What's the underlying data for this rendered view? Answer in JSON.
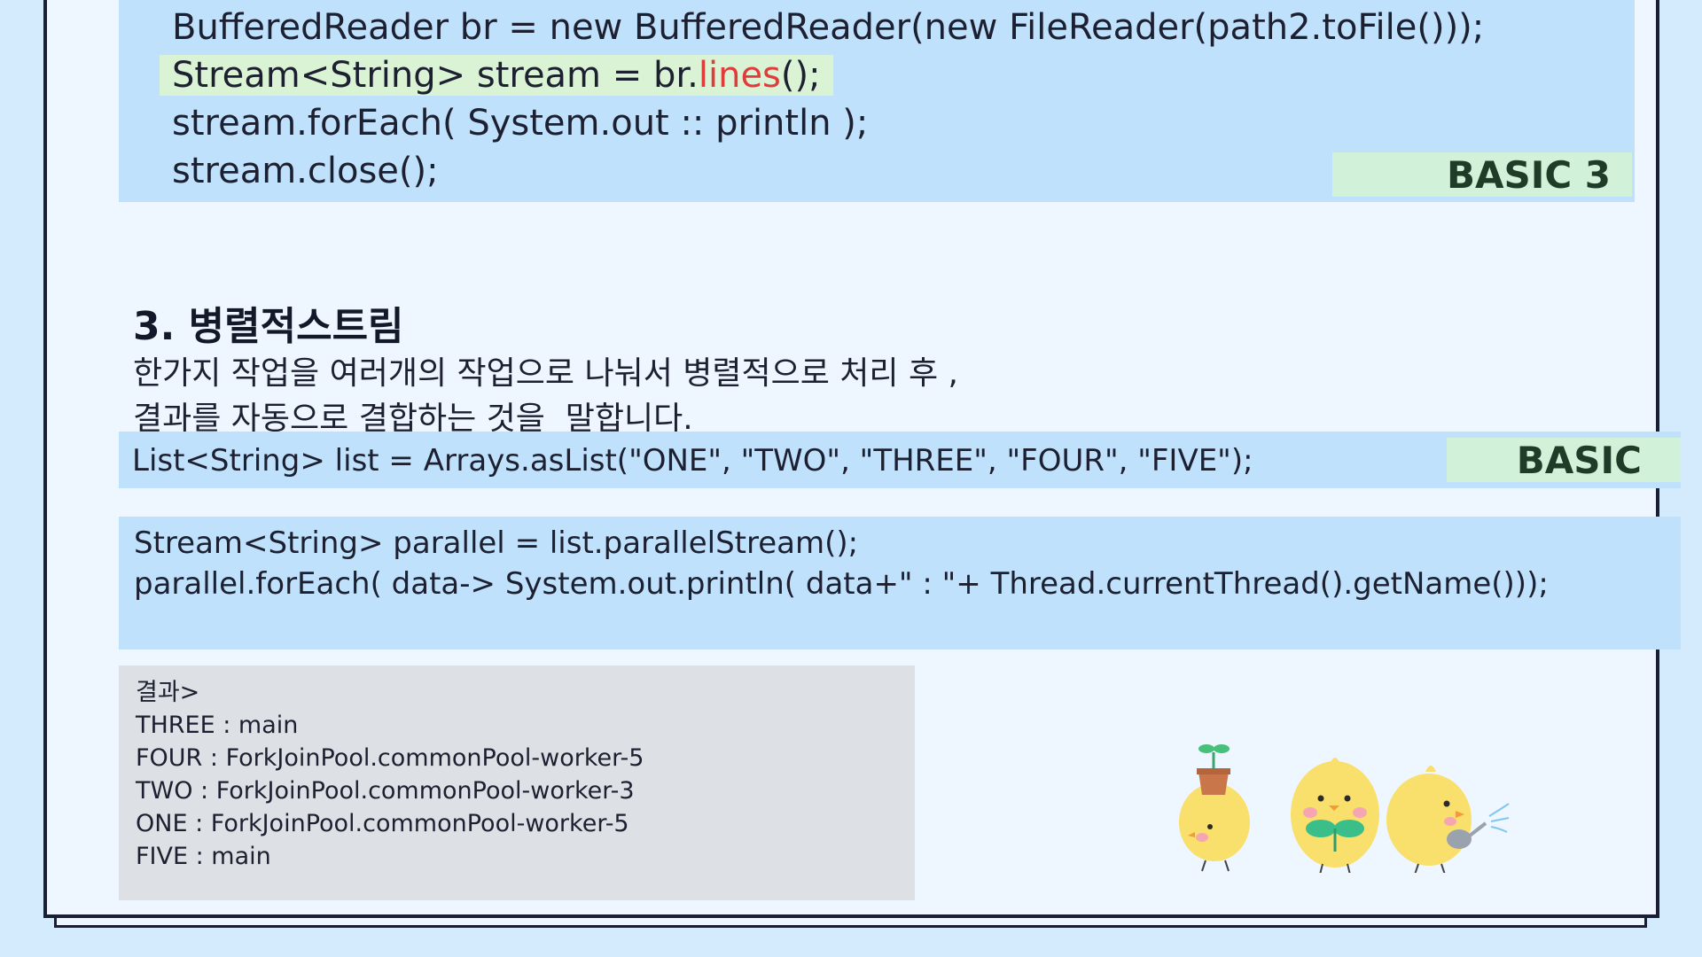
{
  "code_top": {
    "lines": [
      "BufferedReader br = new BufferedReader(new FileReader(path2.toFile()));",
      "Stream<String> stream = br.",
      "stream.forEach( System.out :: println );",
      "stream.close();"
    ],
    "line2_method": "lines",
    "line2_suffix": "();",
    "tag": "BASIC 3"
  },
  "section": {
    "heading": "3. 병렬적스트림",
    "desc_line1": "한가지 작업을 여러개의 작업으로 나눠서 병렬적으로 처리 후 ,",
    "desc_line2": "결과를 자동으로 결합하는 것을  말합니다."
  },
  "list_code": {
    "line": "List<String> list = Arrays.asList(\"ONE\", \"TWO\", \"THREE\", \"FOUR\", \"FIVE\");",
    "tag": "BASIC"
  },
  "parallel_code": {
    "line1": "Stream<String> parallel = list.parallelStream();",
    "line2": "parallel.forEach( data-> System.out.println( data+\" : \"+ Thread.currentThread().getName()));"
  },
  "result": {
    "title": "결과>",
    "lines": [
      "THREE : main",
      "FOUR : ForkJoinPool.commonPool-worker-5",
      "TWO : ForkJoinPool.commonPool-worker-3",
      "ONE : ForkJoinPool.commonPool-worker-5",
      "FIVE : main"
    ]
  },
  "colors": {
    "background": "#d4ebfd",
    "sheet": "#eef6ff",
    "code_band": "#bfe1fc",
    "tag_bg": "#d1f2d9",
    "highlight": "#e03c3c",
    "result_bg": "#dde1e5"
  },
  "icons": [
    "chick-with-sprout-pot-icon",
    "chick-holding-leaf-icon",
    "chick-with-watering-can-icon"
  ]
}
